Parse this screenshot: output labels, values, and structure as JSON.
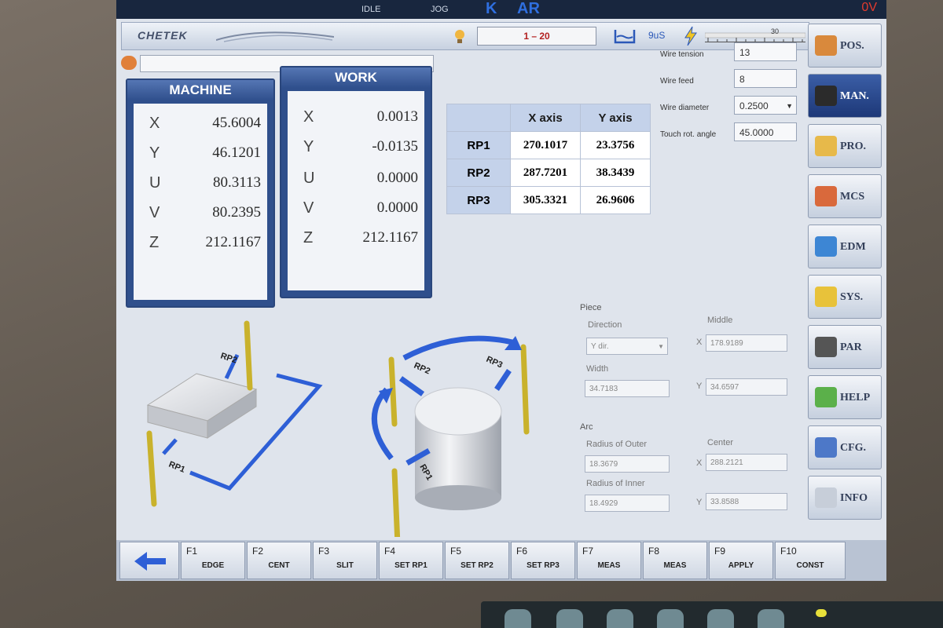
{
  "status_bar": {
    "idle": "IDLE",
    "jog": "JOG",
    "k": "K",
    "ar": "AR",
    "voltage": "0V"
  },
  "header": {
    "logo": "CHETEK",
    "range": "1 – 20",
    "pulse": "9uS",
    "gauge_mark": "30"
  },
  "machine": {
    "title": "MACHINE",
    "rows": [
      {
        "axis": "X",
        "value": "45.6004"
      },
      {
        "axis": "Y",
        "value": "46.1201"
      },
      {
        "axis": "U",
        "value": "80.3113"
      },
      {
        "axis": "V",
        "value": "80.2395"
      },
      {
        "axis": "Z",
        "value": "212.1167"
      }
    ]
  },
  "work": {
    "title": "WORK",
    "rows": [
      {
        "axis": "X",
        "value": "0.0013"
      },
      {
        "axis": "Y",
        "value": "-0.0135"
      },
      {
        "axis": "U",
        "value": "0.0000"
      },
      {
        "axis": "V",
        "value": "0.0000"
      },
      {
        "axis": "Z",
        "value": "212.1167"
      }
    ]
  },
  "rp_table": {
    "headers": [
      "X axis",
      "Y axis"
    ],
    "rows": [
      {
        "name": "RP1",
        "x": "270.1017",
        "y": "23.3756"
      },
      {
        "name": "RP2",
        "x": "287.7201",
        "y": "38.3439"
      },
      {
        "name": "RP3",
        "x": "305.3321",
        "y": "26.9606"
      }
    ]
  },
  "params": {
    "wire_tension_label": "Wire tension",
    "wire_tension": "13",
    "wire_feed_label": "Wire feed",
    "wire_feed": "8",
    "wire_diameter_label": "Wire diameter",
    "wire_diameter": "0.2500",
    "touch_label": "Touch rot. angle",
    "touch": "45.0000"
  },
  "side_menu": [
    {
      "label": "POS.",
      "icon": "position-icon",
      "color": "#d9893c"
    },
    {
      "label": "MAN.",
      "icon": "manual-icon",
      "color": "#2b2b2b"
    },
    {
      "label": "PRO.",
      "icon": "program-icon",
      "color": "#e7b94a"
    },
    {
      "label": "MCS",
      "icon": "mcs-icon",
      "color": "#d9693c"
    },
    {
      "label": "EDM",
      "icon": "edm-icon",
      "color": "#3d86d4"
    },
    {
      "label": "SYS.",
      "icon": "system-icon",
      "color": "#e8c23a"
    },
    {
      "label": "PAR",
      "icon": "parameter-icon",
      "color": "#555555"
    },
    {
      "label": "HELP",
      "icon": "help-icon",
      "color": "#5bb04a"
    },
    {
      "label": "CFG.",
      "icon": "config-icon",
      "color": "#4d78c8"
    },
    {
      "label": "INFO",
      "icon": "info-icon",
      "color": "#c7ced9"
    }
  ],
  "illustration": {
    "rp1": "RP1",
    "rp2": "RP2",
    "rp3": "RP3"
  },
  "piece": {
    "title": "Piece",
    "direction_label": "Direction",
    "direction": "Y dir.",
    "middle_label": "Middle",
    "middle_x": "178.9189",
    "middle_y": "34.6597",
    "width_label": "Width",
    "width": "34.7183",
    "x": "X",
    "y": "Y"
  },
  "arc": {
    "title": "Arc",
    "outer_label": "Radius of Outer",
    "outer": "18.3679",
    "center_label": "Center",
    "center_x": "288.2121",
    "inner_label": "Radius of Inner",
    "inner": "18.4929",
    "center_y": "33.8588",
    "x": "X",
    "y": "Y"
  },
  "fkeys": [
    {
      "num": "F1",
      "label": "EDGE"
    },
    {
      "num": "F2",
      "label": "CENT"
    },
    {
      "num": "F3",
      "label": "SLIT"
    },
    {
      "num": "F4",
      "label": "SET RP1"
    },
    {
      "num": "F5",
      "label": "SET RP2"
    },
    {
      "num": "F6",
      "label": "SET RP3"
    },
    {
      "num": "F7",
      "label": "MEAS"
    },
    {
      "num": "F8",
      "label": "MEAS"
    },
    {
      "num": "F9",
      "label": "APPLY"
    },
    {
      "num": "F10",
      "label": "CONST"
    }
  ]
}
